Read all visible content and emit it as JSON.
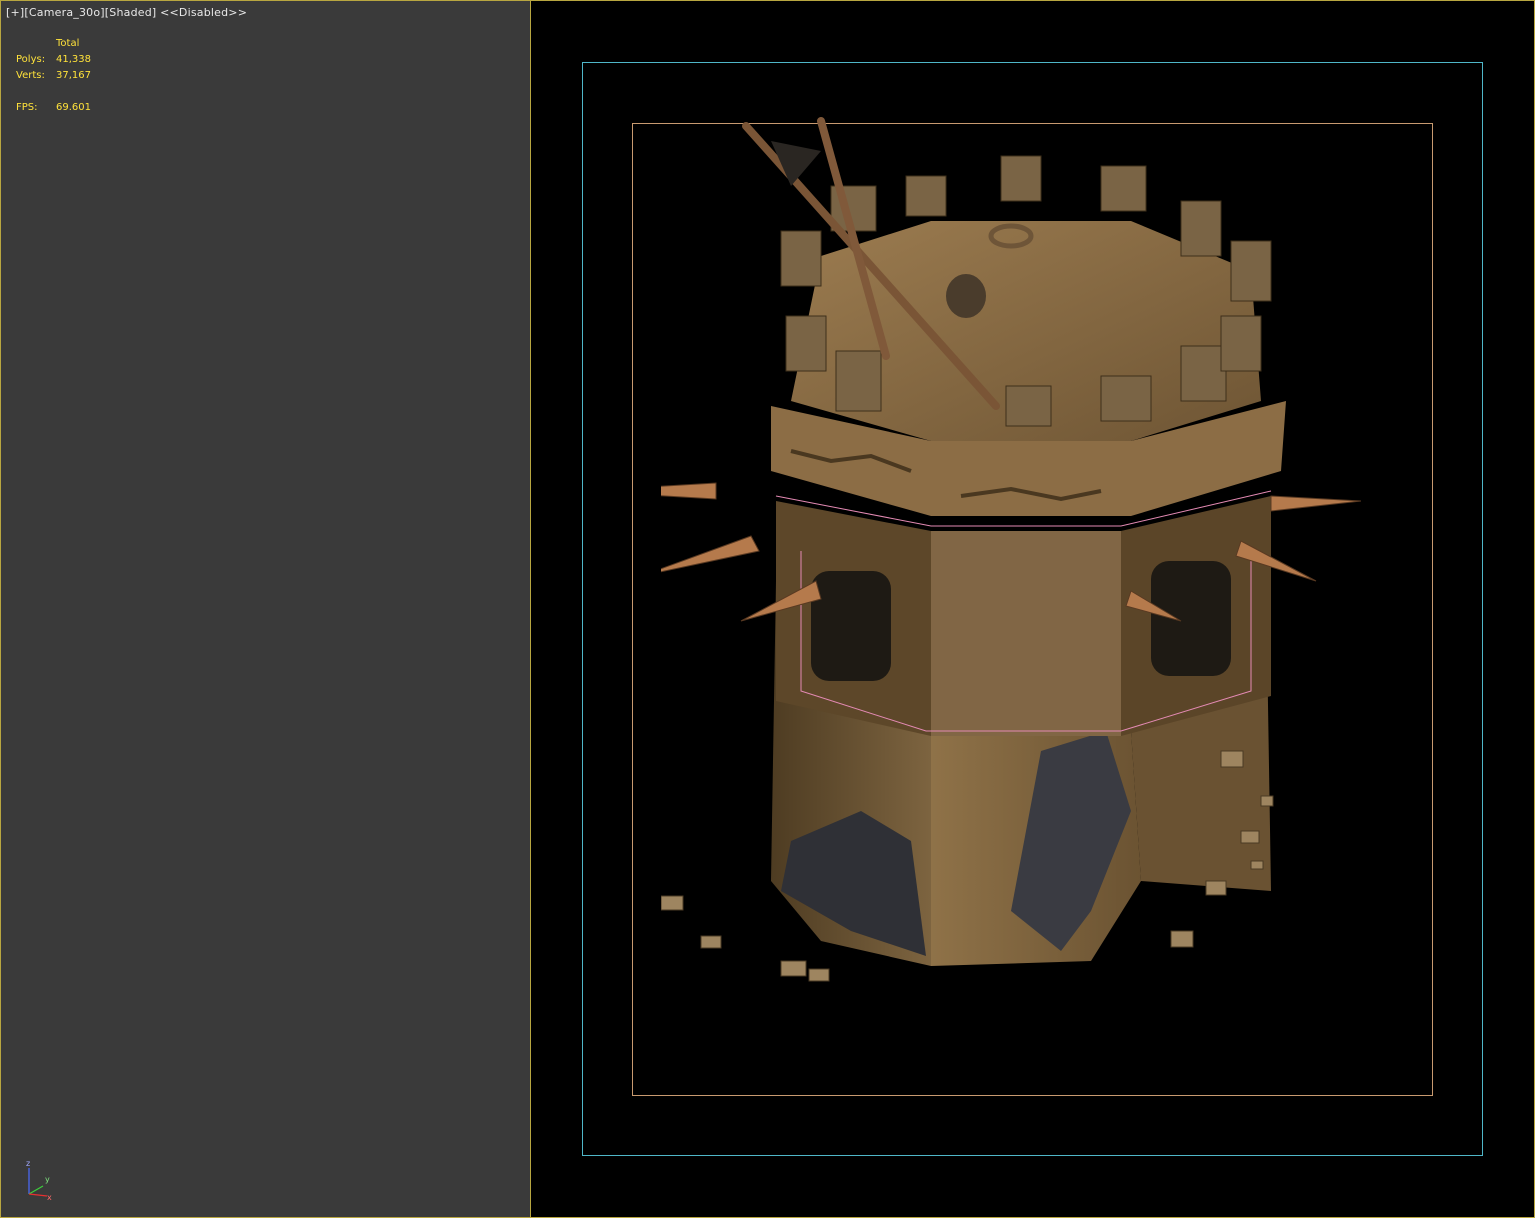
{
  "viewport": {
    "label": "[+][Camera_30o][Shaded] <<Disabled>>"
  },
  "stats": {
    "header": "Total",
    "polys_label": "Polys:",
    "polys_value": "41,338",
    "verts_label": "Verts:",
    "verts_value": "37,167",
    "fps_label": "FPS:",
    "fps_value": "69.601"
  },
  "axis": {
    "z": "z",
    "y": "y",
    "x": "x"
  },
  "colors": {
    "panel_bg": "#3a3a3a",
    "panel_border": "#b8a640",
    "stats_text": "#ffe23a",
    "safe_frame_outer": "#4fb6c8",
    "safe_frame_inner": "#c89a70"
  },
  "scene": {
    "object_icon": "ruined-watchtower-model"
  }
}
